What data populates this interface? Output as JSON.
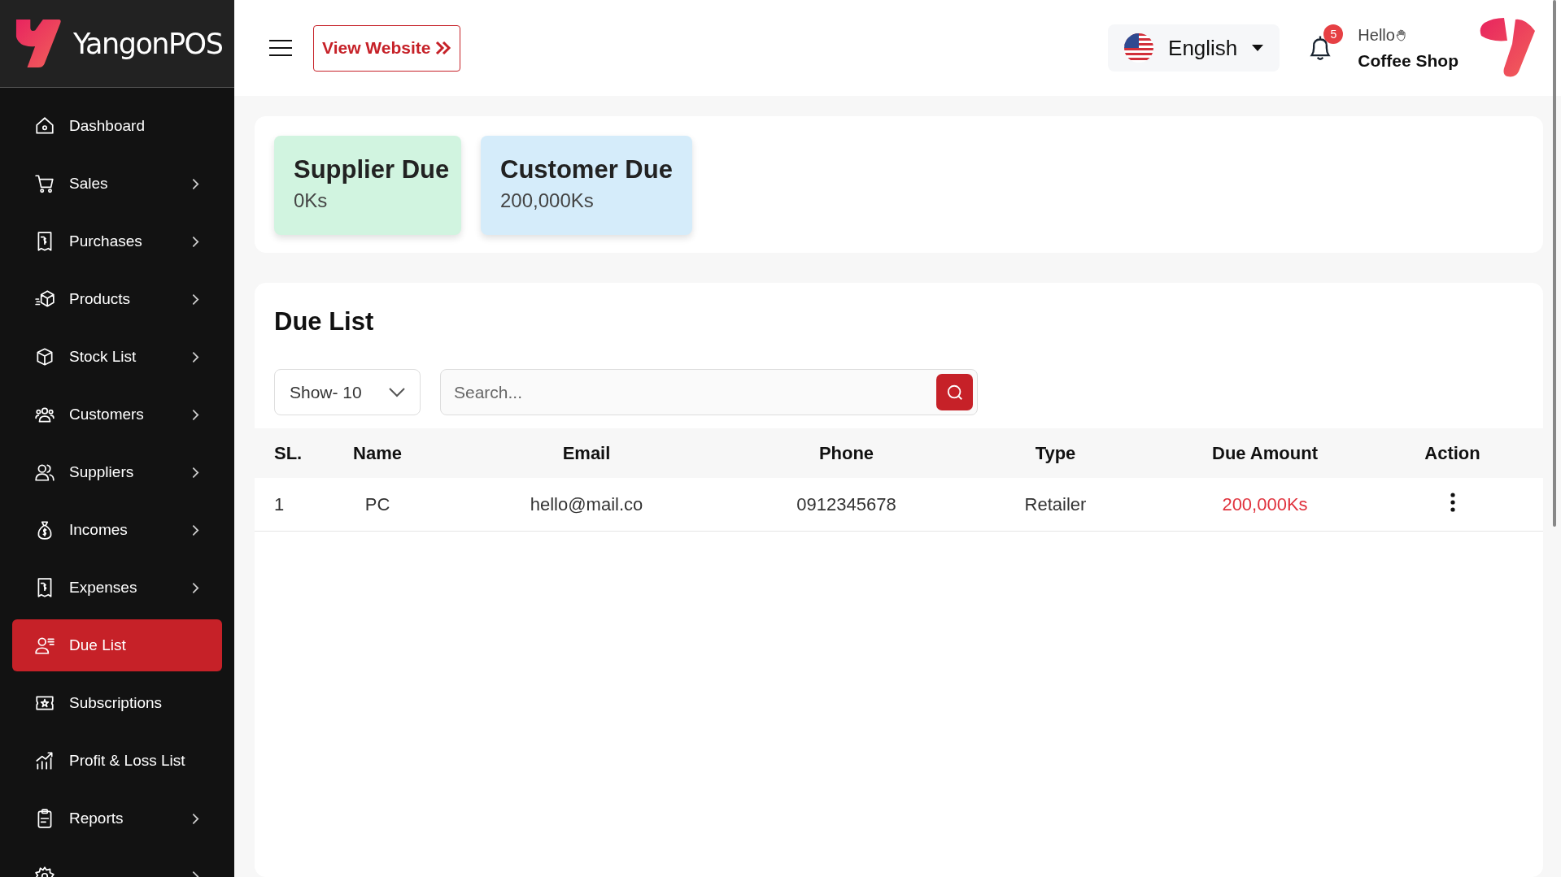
{
  "brand": {
    "name": "YangonPOS"
  },
  "header": {
    "view_website": "View Website",
    "language": "English",
    "notifications": "5",
    "greeting": "Hello",
    "shop_name": "Coffee Shop"
  },
  "sidebar": {
    "items": [
      {
        "label": "Dashboard",
        "has_children": false,
        "selected": false
      },
      {
        "label": "Sales",
        "has_children": true,
        "selected": false
      },
      {
        "label": "Purchases",
        "has_children": true,
        "selected": false
      },
      {
        "label": "Products",
        "has_children": true,
        "selected": false
      },
      {
        "label": "Stock List",
        "has_children": true,
        "selected": false
      },
      {
        "label": "Customers",
        "has_children": true,
        "selected": false
      },
      {
        "label": "Suppliers",
        "has_children": true,
        "selected": false
      },
      {
        "label": "Incomes",
        "has_children": true,
        "selected": false
      },
      {
        "label": "Expenses",
        "has_children": true,
        "selected": false
      },
      {
        "label": "Due List",
        "has_children": false,
        "selected": true
      },
      {
        "label": "Subscriptions",
        "has_children": false,
        "selected": false
      },
      {
        "label": "Profit & Loss List",
        "has_children": false,
        "selected": false
      },
      {
        "label": "Reports",
        "has_children": true,
        "selected": false
      },
      {
        "has_children": true,
        "selected": false
      }
    ]
  },
  "summary_cards": [
    {
      "title": "Supplier Due",
      "value": "0Ks",
      "color": "#d1f4e0"
    },
    {
      "title": "Customer Due",
      "value": "200,000Ks",
      "color": "#d5ecfa"
    }
  ],
  "due_list": {
    "title": "Due List",
    "page_size": "Show- 10",
    "search": {
      "placeholder": "Search..."
    },
    "columns": [
      "SL.",
      "Name",
      "Email",
      "Phone",
      "Type",
      "Due Amount",
      "Action"
    ],
    "rows": [
      {
        "sl": "1",
        "name": "PC",
        "email": "hello@mail.co",
        "phone": "0912345678",
        "type": "Retailer",
        "due_amount": "200,000Ks"
      }
    ]
  }
}
